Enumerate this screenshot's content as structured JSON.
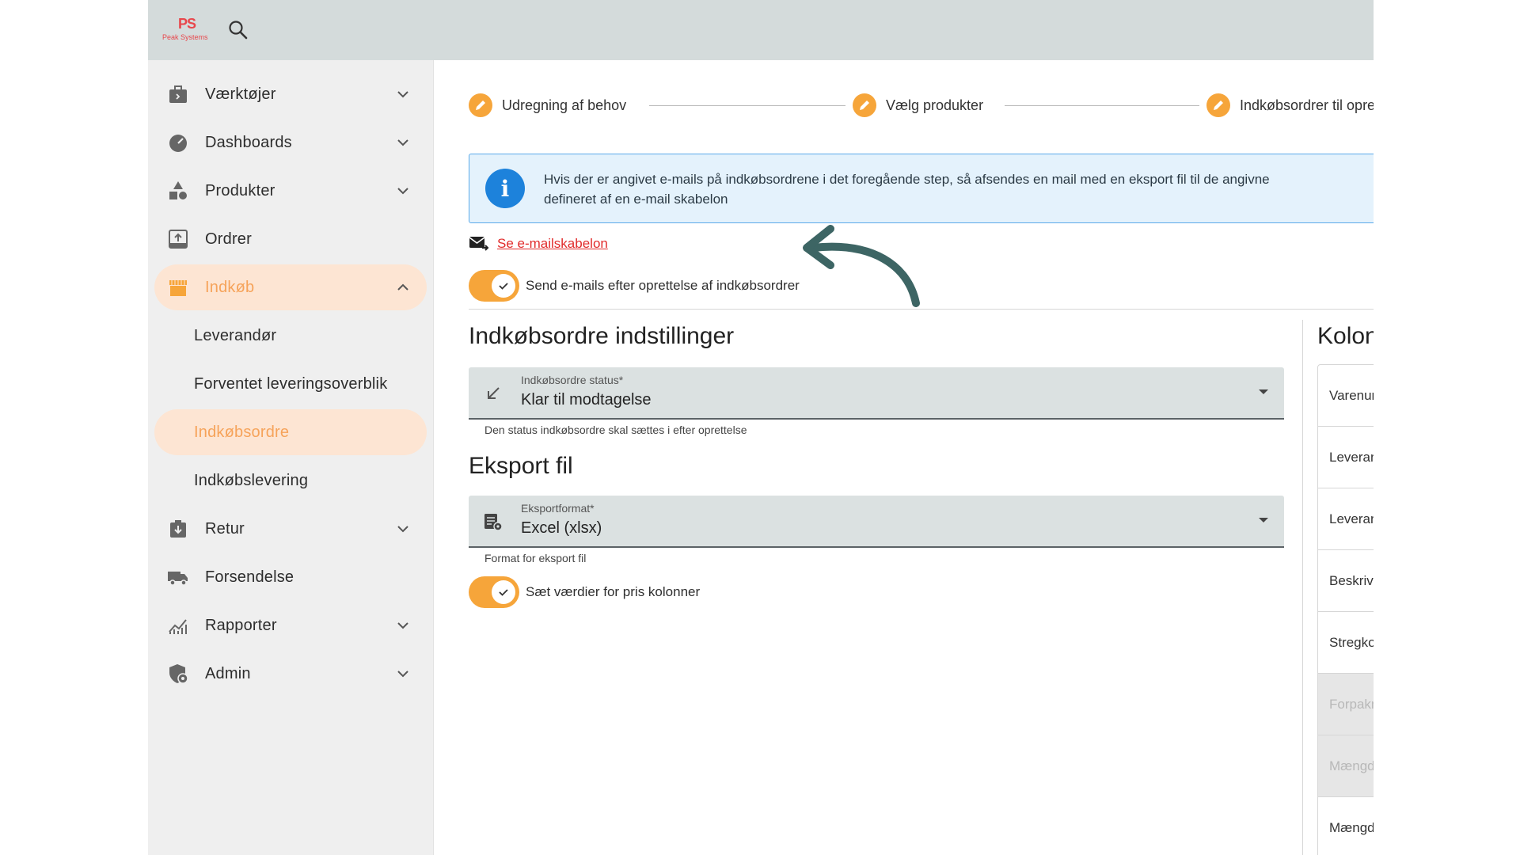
{
  "app": {
    "logo_mark": "PS",
    "logo_text": "Peak Systems"
  },
  "sidebar": {
    "items": [
      {
        "label": "Værktøjer",
        "icon": "toolbox-icon",
        "chevron": "down"
      },
      {
        "label": "Dashboards",
        "icon": "speedometer-icon",
        "chevron": "down"
      },
      {
        "label": "Produkter",
        "icon": "shapes-icon",
        "chevron": "down"
      },
      {
        "label": "Ordrer",
        "icon": "order-icon",
        "chevron": ""
      },
      {
        "label": "Indkøb",
        "icon": "store-icon",
        "chevron": "up"
      },
      {
        "label": "Retur",
        "icon": "return-icon",
        "chevron": "down"
      },
      {
        "label": "Forsendelse",
        "icon": "truck-icon",
        "chevron": ""
      },
      {
        "label": "Rapporter",
        "icon": "chart-icon",
        "chevron": "down"
      },
      {
        "label": "Admin",
        "icon": "shield-icon",
        "chevron": "down"
      }
    ],
    "sub_items": [
      "Leverandør",
      "Forventet leveringsoverblik",
      "Indkøbsordre",
      "Indkøbslevering"
    ]
  },
  "stepper": {
    "steps": [
      "Udregning af behov",
      "Vælg produkter",
      "Indkøbsordrer til opre"
    ]
  },
  "info": {
    "line1": "Hvis der er angivet e-mails på indkøbsordrene i det foregående step, så afsendes en mail med en eksport fil til de angivne",
    "line2": "defineret af en e-mail skabelon"
  },
  "mail_link": "Se e-mailskabelon",
  "send_toggle": {
    "label": "Send e-mails efter oprettelse af indkøbsordrer",
    "checked": true
  },
  "settings": {
    "title": "Indkøbsordre indstillinger",
    "status_field": {
      "label": "Indkøbsordre status*",
      "value": "Klar til modtagelse",
      "helper": "Den status indkøbsordre skal sættes i efter oprettelse"
    }
  },
  "export": {
    "title": "Eksport fil",
    "format_field": {
      "label": "Eksportformat*",
      "value": "Excel (xlsx)",
      "helper": "Format for eksport fil"
    },
    "price_toggle": {
      "label": "Sæt værdier for pris kolonner",
      "checked": true
    }
  },
  "columns": {
    "title": "Kolon",
    "items": [
      {
        "label": "Varenur",
        "disabled": false
      },
      {
        "label": "Leveran",
        "disabled": false
      },
      {
        "label": "Leveran",
        "disabled": false
      },
      {
        "label": "Beskrive",
        "disabled": false
      },
      {
        "label": "Stregko",
        "disabled": false
      },
      {
        "label": "Forpakn",
        "disabled": true
      },
      {
        "label": "Mængd",
        "disabled": true
      },
      {
        "label": "Mængd",
        "disabled": false
      }
    ]
  },
  "colors": {
    "accent": "#f6a53a",
    "active_bg": "#fde5d3",
    "info_blue": "#1d82db",
    "link_red": "#e12b2b",
    "arrow": "#3d6564"
  }
}
